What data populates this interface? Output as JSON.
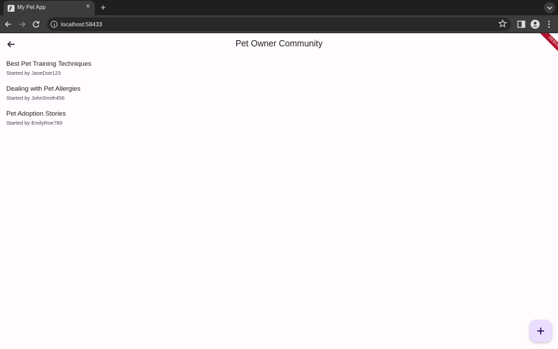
{
  "browser": {
    "tab_title": "My Pet App",
    "tab_close": "×",
    "new_tab": "+",
    "url": "localhost:58433"
  },
  "app": {
    "title": "Pet Owner Community",
    "debug_label": "DEBUG",
    "threads": [
      {
        "title": "Best Pet Training Techniques",
        "author_line": "Started by JaneDoe123"
      },
      {
        "title": "Dealing with Pet Allergies",
        "author_line": "Started by JohnSmith456"
      },
      {
        "title": "Pet Adoption Stories",
        "author_line": "Started by EmilyRoe789"
      }
    ]
  },
  "colors": {
    "background": "#fffbfe",
    "fab": "#eaddff",
    "debug_banner": "#b0102c"
  },
  "icons": {
    "back": "arrow-back-icon",
    "fab": "add-icon"
  }
}
